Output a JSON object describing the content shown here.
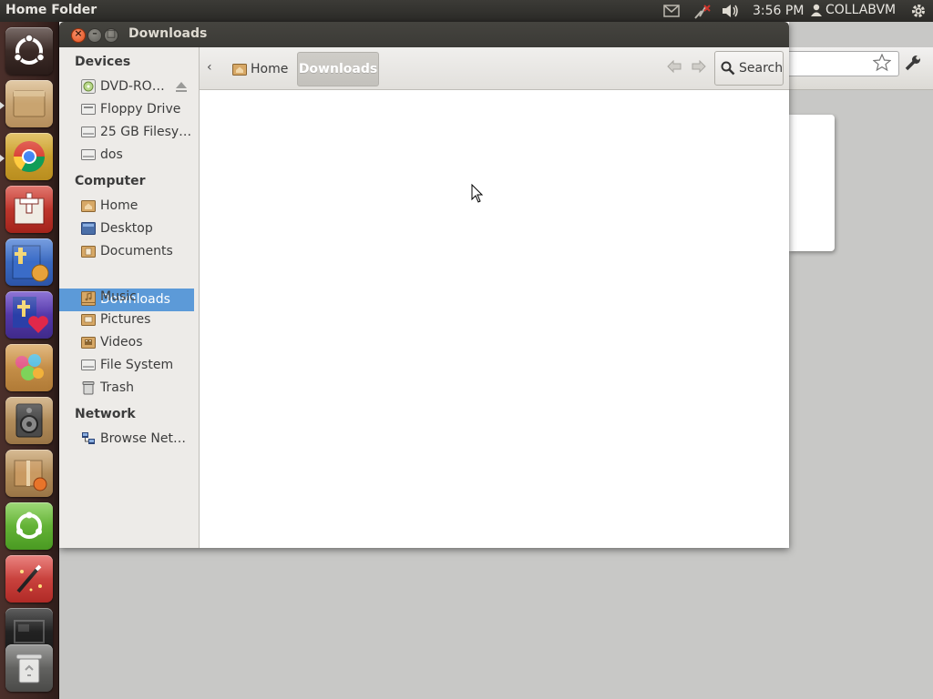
{
  "top_panel": {
    "title": "Home Folder",
    "clock": "3:56 PM",
    "user": "COLLABVM"
  },
  "launcher": {
    "items": [
      {
        "name": "Dash home",
        "icon": "ubuntu-logo-icon"
      },
      {
        "name": "Files",
        "icon": "file-manager-icon"
      },
      {
        "name": "Chrome",
        "icon": "chrome-icon"
      },
      {
        "name": "Bible app",
        "icon": "bible-icon"
      },
      {
        "name": "Bible app 2",
        "icon": "bible-blue-icon"
      },
      {
        "name": "Cross heart app",
        "icon": "cross-heart-icon"
      },
      {
        "name": "Paint app",
        "icon": "paint-icon"
      },
      {
        "name": "Speaker app",
        "icon": "speaker-icon"
      },
      {
        "name": "Software package",
        "icon": "package-icon"
      },
      {
        "name": "Ubuntu software",
        "icon": "ubuntu-software-icon"
      },
      {
        "name": "Magic wand app",
        "icon": "magic-wand-icon"
      },
      {
        "name": "Workspace switcher",
        "icon": "workspace-icon"
      },
      {
        "name": "Trash",
        "icon": "trash-icon"
      }
    ]
  },
  "window": {
    "title": "Downloads"
  },
  "sidebar": {
    "sections": [
      {
        "heading": "Devices",
        "items": [
          {
            "label": "DVD-RO…",
            "icon": "dvd-icon"
          },
          {
            "label": "Floppy Drive",
            "icon": "floppy-icon"
          },
          {
            "label": "25 GB Filesy…",
            "icon": "harddisk-icon"
          },
          {
            "label": "dos",
            "icon": "harddisk-icon"
          }
        ]
      },
      {
        "heading": "Computer",
        "items": [
          {
            "label": "Home",
            "icon": "home-folder-icon"
          },
          {
            "label": "Desktop",
            "icon": "desktop-icon"
          },
          {
            "label": "Documents",
            "icon": "documents-folder-icon"
          },
          {
            "label": "Downloads",
            "icon": "downloads-folder-icon",
            "selected": true
          },
          {
            "label": "Music",
            "icon": "music-folder-icon"
          },
          {
            "label": "Pictures",
            "icon": "pictures-folder-icon"
          },
          {
            "label": "Videos",
            "icon": "videos-folder-icon"
          },
          {
            "label": "File System",
            "icon": "filesystem-icon"
          },
          {
            "label": "Trash",
            "icon": "trash-icon"
          }
        ]
      },
      {
        "heading": "Network",
        "items": [
          {
            "label": "Browse Net…",
            "icon": "network-icon"
          }
        ]
      }
    ]
  },
  "toolbar": {
    "breadcrumbs": [
      "Home",
      "Downloads"
    ],
    "search_label": "Search"
  },
  "colors": {
    "selection": "#5c9ad8",
    "panel": "#3c3b37",
    "launcher": "#3d2622"
  }
}
